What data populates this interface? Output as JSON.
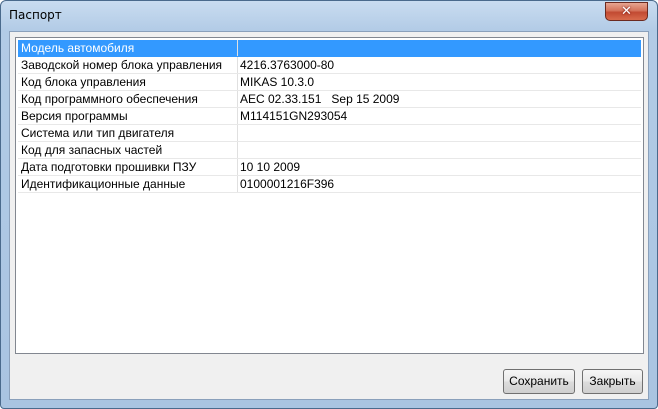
{
  "window": {
    "title": "Паспорт",
    "close_glyph": "✕"
  },
  "table": {
    "selected_index": 0,
    "rows": [
      {
        "label": "Модель автомобиля",
        "value": ""
      },
      {
        "label": "Заводской номер блока управления",
        "value": "4216.3763000-80"
      },
      {
        "label": "Код блока управления",
        "value": "MIKAS 10.3.0"
      },
      {
        "label": "Код программного обеспечения",
        "value": "AEC 02.33.151   Sep 15 2009"
      },
      {
        "label": "Версия программы",
        "value": "M114151GN293054"
      },
      {
        "label": "Система или тип двигателя",
        "value": ""
      },
      {
        "label": "Код для запасных частей",
        "value": ""
      },
      {
        "label": "Дата подготовки прошивки ПЗУ",
        "value": "10 10 2009"
      },
      {
        "label": "Идентификационные данные",
        "value": "0100001216F396"
      }
    ]
  },
  "buttons": {
    "save_label": "Сохранить",
    "close_label": "Закрыть"
  },
  "colors": {
    "selection": "#3399ff",
    "close_button": "#c24a32",
    "frame": "#b2cbe6"
  },
  "icons": {
    "close": "close-icon"
  }
}
